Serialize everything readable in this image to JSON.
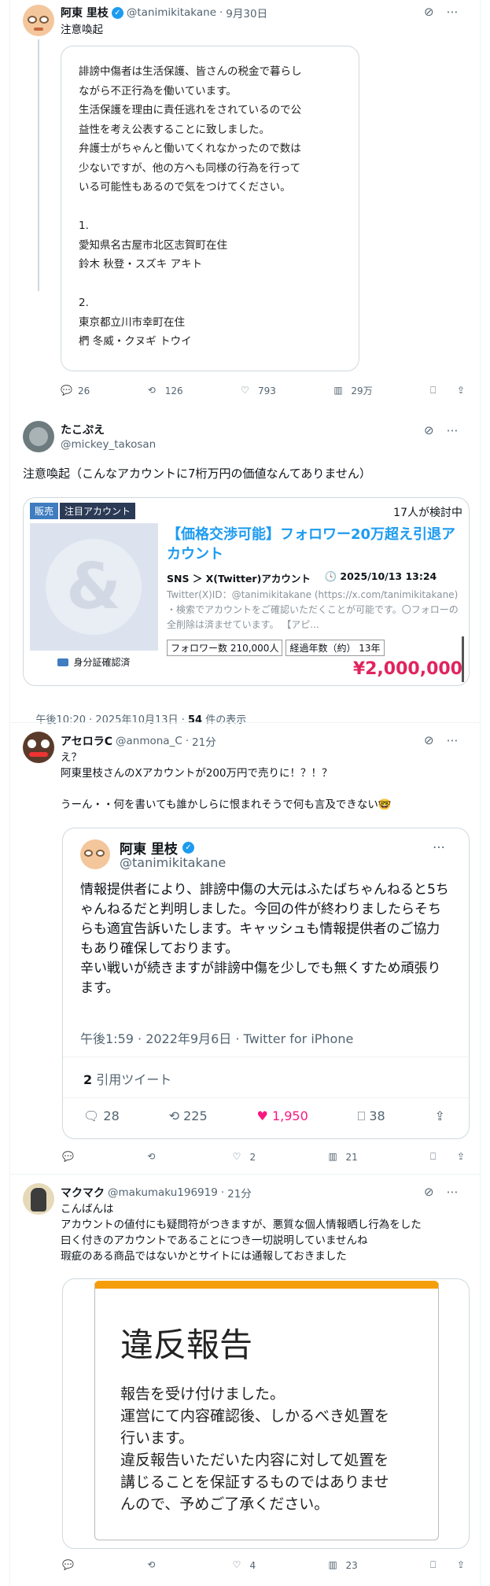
{
  "tweet1": {
    "name": "阿東 里枝",
    "handle": "@tanimikitakane",
    "time": "9月30日",
    "text": "注意喚起",
    "card_text": "誹謗中傷者は生活保護、皆さんの税金で暮らし\nながら不正行為を働いています。\n生活保護を理由に責任逃れをされているので公\n益性を考え公表することに致しました。\n弁護士がちゃんと働いてくれなかったので数は\n少ないですが、他の方へも同様の行為を行って\nいる可能性もあるので気をつけてください。\n\n1.\n愛知県名古屋市北区志賀町在住\n鈴木 秋登・スズキ アキト\n\n2.\n東京都立川市幸町在住\n椚 冬威・クヌギ トウイ",
    "replies": "26",
    "retweets": "126",
    "likes": "793",
    "views": "29万"
  },
  "tweet2": {
    "name": "たこぷえ",
    "handle": "@mickey_takosan",
    "text": "注意喚起（こんなアカウントに7桁万円の価値なんてありません）",
    "listing": {
      "tag1": "販売",
      "tag2": "注目アカウント",
      "watchers": "17人が検討中",
      "title": "【価格交渉可能】フォロワー20万超え引退アカウント",
      "category": "SNS ＞ X(Twitter)アカウント",
      "date": "2025/10/13 13:24",
      "desc": "Twitter(X)ID：@tanimikitakane (https://x.com/tanimikitakane) ・検索でアカウントをご確認いただくことが可能です。〇フォローの全削除は済ませています。 【アピ...",
      "followers": "フォロワー数 210,000人",
      "years": "経過年数（約） 13年",
      "verified_label": "身分証確認済",
      "price": "¥2,000,000"
    },
    "timestamp": "午後10:20 · 2025年10月13日 · ",
    "views_count": "54",
    "views_label": " 件の表示"
  },
  "tweet3": {
    "name": "アセロラC",
    "handle": "@anmona_C",
    "time": "21分",
    "text": "え？\n阿東里枝さんのXアカウントが200万円で売りに！？！？\n\nうーん・・何を書いても誰かしらに恨まれそうで何も言及できない🤓",
    "quote": {
      "name": "阿東 里枝",
      "handle": "@tanimikitakane",
      "text": "情報提供者により、誹謗中傷の大元はふたばちゃんねると5ちゃんねるだと判明しました。今回の件が終わりましたらそちらも適宜告訴いたします。キャッシュも情報提供者のご協力もあり確保しております。\n辛い戦いが続きますが誹謗中傷を少しでも無くすため頑張ります。",
      "meta": "午後1:59 · 2022年9月6日 · Twitter for iPhone",
      "quote_count": "2",
      "quote_label": "引用ツイート",
      "replies": "28",
      "retweets": "225",
      "likes": "1,950",
      "bookmarks": "38"
    },
    "replies": "",
    "retweets": "",
    "likes": "2",
    "views": "21"
  },
  "tweet4": {
    "name": "マクマク",
    "handle": "@makumaku196919",
    "time": "21分",
    "text": "こんばんは\nアカウントの値付にも疑問符がつきますが、悪質な個人情報晒し行為をした\n曰く付きのアカウントであることにつき一切説明していませんね\n瑕疵のある商品ではないかとサイトには通報しておきました",
    "report_title": "違反報告",
    "report_body": "報告を受け付けました。\n運営にて内容確認後、しかるべき処置を\n行います。\n違反報告いただいた内容に対して処置を\n講じることを保証するものではありませ\nんので、予めご了承ください。",
    "replies": "",
    "retweets": "",
    "likes": "4",
    "views": "23"
  },
  "colors": {
    "accent": "#1d9bf0",
    "like": "#f91880",
    "price": "#e0245e",
    "orange": "#f59e0b"
  }
}
